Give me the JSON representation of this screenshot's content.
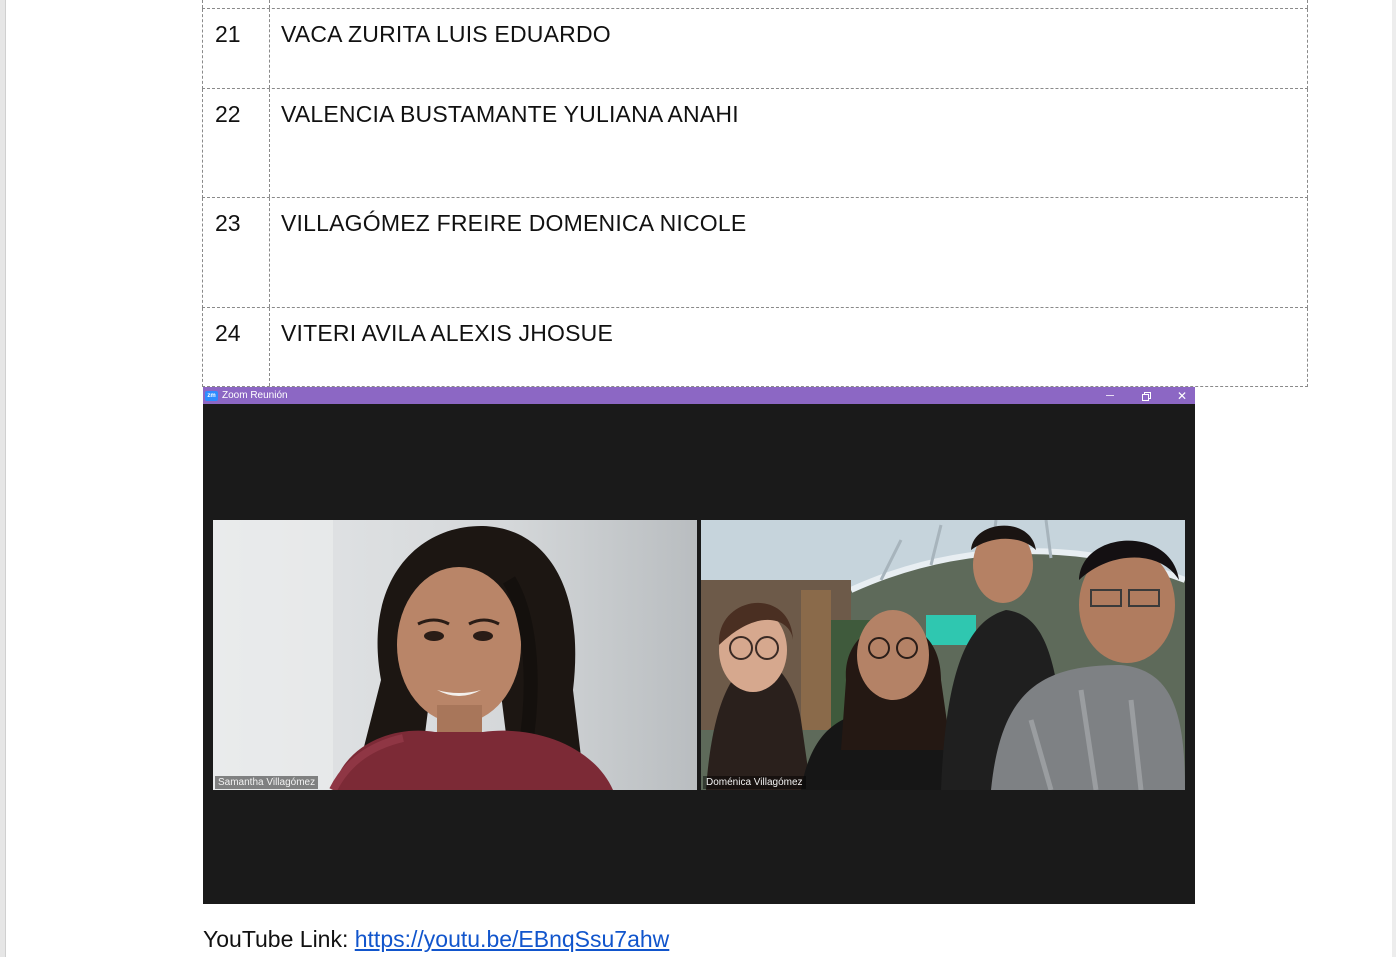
{
  "table": {
    "rows": [
      {
        "num": "21",
        "name": "VACA ZURITA LUIS EDUARDO"
      },
      {
        "num": "22",
        "name": "VALENCIA BUSTAMANTE YULIANA ANAHI"
      },
      {
        "num": "23",
        "name": "VILLAGÓMEZ FREIRE DOMENICA NICOLE"
      },
      {
        "num": "24",
        "name": "VITERI AVILA ALEXIS JHOSUE"
      }
    ]
  },
  "zoom": {
    "logo": "zm",
    "title": "Zoom Reunión",
    "controls": {
      "minimize": "minimize-icon",
      "restore": "restore-icon",
      "close": "close-icon",
      "close_glyph": "✕"
    },
    "participants": [
      {
        "name": "Samantha Villagómez"
      },
      {
        "name": "Doménica Villagómez"
      }
    ],
    "colors": {
      "titlebar": "#8c67c4",
      "background": "#1a1a1a"
    }
  },
  "footer": {
    "label": "YouTube Link: ",
    "url": "https://youtu.be/EBnqSsu7ahw"
  }
}
